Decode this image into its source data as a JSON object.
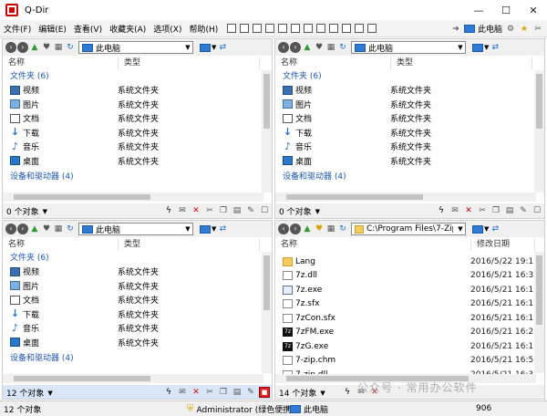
{
  "window": {
    "title": "Q-Dir"
  },
  "menu": [
    "文件(F)",
    "编辑(E)",
    "查看(V)",
    "收藏夹(A)",
    "选项(X)",
    "帮助(H)"
  ],
  "menu_right_label": "此电脑",
  "panes": {
    "tl": {
      "address": "此电脑",
      "columns": [
        "名称",
        "类型"
      ],
      "group_folders": "文件夹 (6)",
      "rows": [
        {
          "icon": "video",
          "name": "视频",
          "type": "系统文件夹"
        },
        {
          "icon": "pic",
          "name": "图片",
          "type": "系统文件夹"
        },
        {
          "icon": "doc",
          "name": "文档",
          "type": "系统文件夹"
        },
        {
          "icon": "down",
          "name": "下载",
          "type": "系统文件夹"
        },
        {
          "icon": "music",
          "name": "音乐",
          "type": "系统文件夹"
        },
        {
          "icon": "desk",
          "name": "桌面",
          "type": "系统文件夹"
        }
      ],
      "group_drives": "设备和驱动器 (4)",
      "status": "0 个对象"
    },
    "tr": {
      "address": "此电脑",
      "columns": [
        "名称",
        "类型"
      ],
      "group_folders": "文件夹 (6)",
      "rows": [
        {
          "icon": "video",
          "name": "视频",
          "type": "系统文件夹"
        },
        {
          "icon": "pic",
          "name": "图片",
          "type": "系统文件夹"
        },
        {
          "icon": "doc",
          "name": "文档",
          "type": "系统文件夹"
        },
        {
          "icon": "down",
          "name": "下载",
          "type": "系统文件夹"
        },
        {
          "icon": "music",
          "name": "音乐",
          "type": "系统文件夹"
        },
        {
          "icon": "desk",
          "name": "桌面",
          "type": "系统文件夹"
        }
      ],
      "group_drives": "设备和驱动器 (4)",
      "status": "0 个对象"
    },
    "bl": {
      "address": "此电脑",
      "columns": [
        "名称",
        "类型"
      ],
      "group_folders": "文件夹 (6)",
      "rows": [
        {
          "icon": "video",
          "name": "视频",
          "type": "系统文件夹"
        },
        {
          "icon": "pic",
          "name": "图片",
          "type": "系统文件夹"
        },
        {
          "icon": "doc",
          "name": "文档",
          "type": "系统文件夹"
        },
        {
          "icon": "down",
          "name": "下载",
          "type": "系统文件夹"
        },
        {
          "icon": "music",
          "name": "音乐",
          "type": "系统文件夹"
        },
        {
          "icon": "desk",
          "name": "桌面",
          "type": "系统文件夹"
        }
      ],
      "group_drives": "设备和驱动器 (4)",
      "status": "12 个对象"
    },
    "br": {
      "address": "C:\\Program Files\\7-Zip",
      "columns": [
        "名称",
        "修改日期"
      ],
      "rows": [
        {
          "icon": "folder",
          "name": "Lang",
          "date": "2016/5/22 19:1"
        },
        {
          "icon": "file",
          "name": "7z.dll",
          "date": "2016/5/21 16:3"
        },
        {
          "icon": "exe",
          "name": "7z.exe",
          "date": "2016/5/21 16:1"
        },
        {
          "icon": "file",
          "name": "7z.sfx",
          "date": "2016/5/21 16:1"
        },
        {
          "icon": "file",
          "name": "7zCon.sfx",
          "date": "2016/5/21 16:1"
        },
        {
          "icon": "7z",
          "name": "7zFM.exe",
          "date": "2016/5/21 16:2"
        },
        {
          "icon": "7z",
          "name": "7zG.exe",
          "date": "2016/5/21 16:1"
        },
        {
          "icon": "file",
          "name": "7-zip.chm",
          "date": "2016/5/21 16:5"
        },
        {
          "icon": "file",
          "name": "7-zip.dll",
          "date": "2016/5/21 16:3"
        }
      ],
      "status": "14 个对象"
    }
  },
  "statusbar": {
    "left": "12 个对象",
    "user": "Administrator (绿色便携",
    "location": "此电脑",
    "number": "906"
  },
  "watermark": "公众号 · 常用办公软件",
  "colors": {
    "accent": "#1b55b8",
    "active_status": "#d8e6f8",
    "close_red": "#d22"
  }
}
